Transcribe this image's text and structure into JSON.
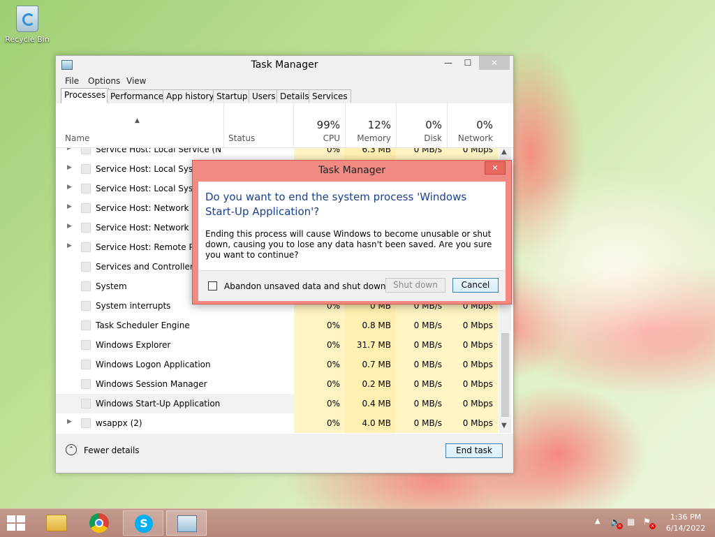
{
  "desktop": {
    "recycle_bin_label": "Recycle Bin"
  },
  "task_manager": {
    "title": "Task Manager",
    "menu": [
      "File",
      "Options",
      "View"
    ],
    "tabs": [
      "Processes",
      "Performance",
      "App history",
      "Startup",
      "Users",
      "Details",
      "Services"
    ],
    "active_tab": "Processes",
    "columns": {
      "name": "Name",
      "status": "Status",
      "cpu": {
        "label": "CPU",
        "total": "99%"
      },
      "memory": {
        "label": "Memory",
        "total": "12%"
      },
      "disk": {
        "label": "Disk",
        "total": "0%"
      },
      "network": {
        "label": "Network",
        "total": "0%"
      }
    },
    "sort_indicator": "▲",
    "rows": [
      {
        "name": "Service Host: Local Service (No ...",
        "expandable": true,
        "cpu": "0%",
        "memory": "6.3 MB",
        "disk": "0 MB/s",
        "network": "0 Mbps"
      },
      {
        "name": "Service Host: Local System",
        "expandable": true,
        "cpu": "",
        "memory": "",
        "disk": "",
        "network": ""
      },
      {
        "name": "Service Host: Local System",
        "expandable": true,
        "cpu": "",
        "memory": "",
        "disk": "",
        "network": ""
      },
      {
        "name": "Service Host: Network Serv",
        "expandable": true,
        "cpu": "",
        "memory": "",
        "disk": "",
        "network": ""
      },
      {
        "name": "Service Host: Network Serv",
        "expandable": true,
        "cpu": "",
        "memory": "",
        "disk": "",
        "network": ""
      },
      {
        "name": "Service Host: Remote Proc",
        "expandable": true,
        "cpu": "",
        "memory": "",
        "disk": "",
        "network": ""
      },
      {
        "name": "Services and Controller ap",
        "expandable": false,
        "cpu": "",
        "memory": "",
        "disk": "",
        "network": ""
      },
      {
        "name": "System",
        "expandable": false,
        "cpu": "",
        "memory": "",
        "disk": "",
        "network": ""
      },
      {
        "name": "System interrupts",
        "expandable": false,
        "cpu": "0%",
        "memory": "0 MB",
        "disk": "0 MB/s",
        "network": "0 Mbps"
      },
      {
        "name": "Task Scheduler Engine",
        "expandable": false,
        "cpu": "0%",
        "memory": "0.8 MB",
        "disk": "0 MB/s",
        "network": "0 Mbps"
      },
      {
        "name": "Windows Explorer",
        "expandable": false,
        "cpu": "0%",
        "memory": "31.7 MB",
        "disk": "0 MB/s",
        "network": "0 Mbps"
      },
      {
        "name": "Windows Logon Application",
        "expandable": false,
        "cpu": "0%",
        "memory": "0.7 MB",
        "disk": "0 MB/s",
        "network": "0 Mbps"
      },
      {
        "name": "Windows Session Manager",
        "expandable": false,
        "cpu": "0%",
        "memory": "0.2 MB",
        "disk": "0 MB/s",
        "network": "0 Mbps"
      },
      {
        "name": "Windows Start-Up Application",
        "expandable": false,
        "selected": true,
        "cpu": "0%",
        "memory": "0.4 MB",
        "disk": "0 MB/s",
        "network": "0 Mbps"
      },
      {
        "name": "wsappx (2)",
        "expandable": true,
        "cpu": "0%",
        "memory": "4.0 MB",
        "disk": "0 MB/s",
        "network": "0 Mbps"
      }
    ],
    "fewer_details_label": "Fewer details",
    "end_task_label": "End task"
  },
  "dialog": {
    "title": "Task Manager",
    "main_instruction": "Do you want to end the system process 'Windows Start-Up Application'?",
    "content": "Ending this process will cause Windows to become unusable or shut down, causing you to lose any data hasn't been saved. Are you sure you want to continue?",
    "checkbox_label": "Abandon unsaved data and shut down.",
    "checkbox_checked": false,
    "shutdown_label": "Shut down",
    "cancel_label": "Cancel"
  },
  "taskbar": {
    "apps": [
      "file-explorer",
      "chrome",
      "skype",
      "task-manager"
    ],
    "clock": {
      "time": "1:36 PM",
      "date": "6/14/2022"
    }
  },
  "colors": {
    "dialog_frame": "#f08a82",
    "dialog_instruction": "#1b3f91",
    "cpu_heat": "#fff4c4",
    "memory_heat": "#ffefb0",
    "taskbar": "#b6867a"
  }
}
